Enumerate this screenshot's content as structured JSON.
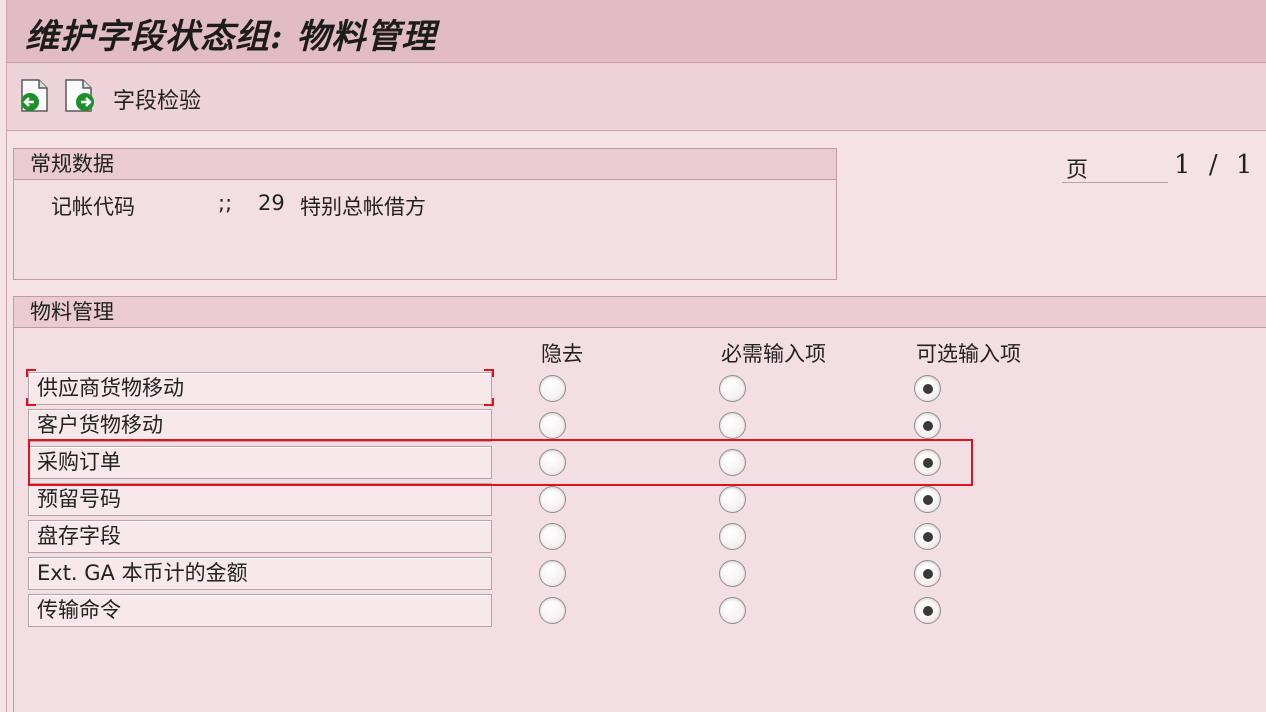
{
  "title": "维护字段状态组: 物料管理",
  "toolbar": {
    "prev_icon": "previous-page-icon",
    "next_icon": "next-page-icon",
    "field_check_label": "字段检验"
  },
  "general": {
    "header": "常规数据",
    "posting_key_label": "记帐代码",
    "posting_key_sep": ";;",
    "posting_key_value": "29",
    "posting_key_desc": "特别总帐借方"
  },
  "page": {
    "label": "页",
    "current": "1",
    "separator": "/",
    "total": "1"
  },
  "material": {
    "header": "物料管理",
    "columns": [
      "隐去",
      "必需输入项",
      "可选输入项"
    ],
    "rows": [
      {
        "label": "供应商货物移动",
        "selected": "可选输入项"
      },
      {
        "label": "客户货物移动",
        "selected": "可选输入项"
      },
      {
        "label": "采购订单",
        "selected": "可选输入项"
      },
      {
        "label": "预留号码",
        "selected": "可选输入项"
      },
      {
        "label": "盘存字段",
        "selected": "可选输入项"
      },
      {
        "label": "Ext. GA 本币计的金额",
        "selected": "可选输入项"
      },
      {
        "label": "传输命令",
        "selected": "可选输入项"
      }
    ]
  },
  "colors": {
    "title_bg": "#e2bcc5",
    "highlight": "#e0121c"
  }
}
